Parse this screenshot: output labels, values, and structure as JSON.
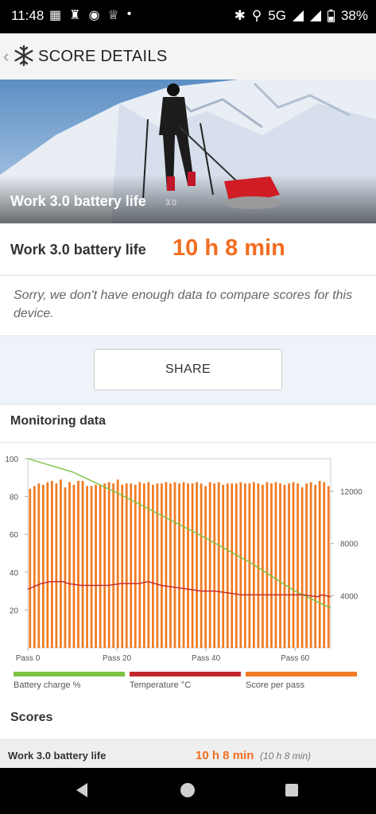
{
  "status": {
    "time": "11:48",
    "network": "5G",
    "battery": "38%"
  },
  "appbar": {
    "title": "SCORE DETAILS"
  },
  "hero": {
    "label": "Work 3.0 battery life",
    "version": "3.0"
  },
  "score": {
    "label": "Work 3.0 battery life",
    "value": "10 h 8 min"
  },
  "notice": "Sorry, we don't have enough data to compare scores for this device.",
  "share_label": "SHARE",
  "monitoring": {
    "title": "Monitoring data"
  },
  "chart_data": {
    "type": "bar",
    "x_tick_labels": [
      "Pass 0",
      "Pass 20",
      "Pass 40",
      "Pass 60"
    ],
    "x_ticks": [
      0,
      20,
      40,
      60
    ],
    "xlim": [
      0,
      68
    ],
    "y_left_ticks": [
      20,
      40,
      60,
      80,
      100
    ],
    "ylim_left": [
      0,
      100
    ],
    "y_right_ticks": [
      4000,
      8000,
      12000
    ],
    "ylim_right": [
      0,
      14500
    ],
    "series": [
      {
        "name": "Battery charge %",
        "type": "line",
        "axis": "left",
        "color": "#7dc242",
        "x": [
          0,
          10,
          20,
          30,
          40,
          50,
          60,
          68
        ],
        "values": [
          100,
          93,
          82,
          70,
          58,
          45,
          30,
          21
        ]
      },
      {
        "name": "Temperature °C",
        "type": "line",
        "axis": "left",
        "color": "#c1272d",
        "x": [
          0,
          3,
          5,
          8,
          9,
          12,
          15,
          18,
          21,
          25,
          27,
          30,
          33,
          36,
          39,
          42,
          45,
          48,
          54,
          58,
          62,
          65,
          66,
          68
        ],
        "values": [
          31,
          34,
          35,
          35,
          34,
          33,
          33,
          33,
          34,
          34,
          35,
          33,
          32,
          31,
          30,
          30,
          29,
          28,
          28,
          28,
          28,
          27,
          28,
          27
        ]
      },
      {
        "name": "Score per pass",
        "type": "bar",
        "axis": "right",
        "color": "#f07b22",
        "values": [
          12200,
          12400,
          12600,
          12500,
          12700,
          12800,
          12600,
          12900,
          12300,
          12700,
          12500,
          12800,
          12800,
          12400,
          12400,
          12500,
          12500,
          12600,
          12700,
          12600,
          12900,
          12500,
          12600,
          12600,
          12500,
          12700,
          12600,
          12700,
          12500,
          12600,
          12600,
          12700,
          12600,
          12700,
          12600,
          12700,
          12600,
          12600,
          12700,
          12600,
          12400,
          12700,
          12600,
          12700,
          12500,
          12600,
          12600,
          12600,
          12700,
          12600,
          12600,
          12700,
          12600,
          12500,
          12700,
          12600,
          12700,
          12600,
          12500,
          12600,
          12700,
          12600,
          12300,
          12600,
          12700,
          12500,
          12800,
          12700,
          12400
        ]
      }
    ],
    "legend_position": "bottom"
  },
  "scores": {
    "title": "Scores",
    "row_name": "Work 3.0 battery life",
    "row_value": "10 h 8 min",
    "row_sub": "(10 h 8 min)"
  },
  "colors": {
    "accent": "#f26d21"
  }
}
